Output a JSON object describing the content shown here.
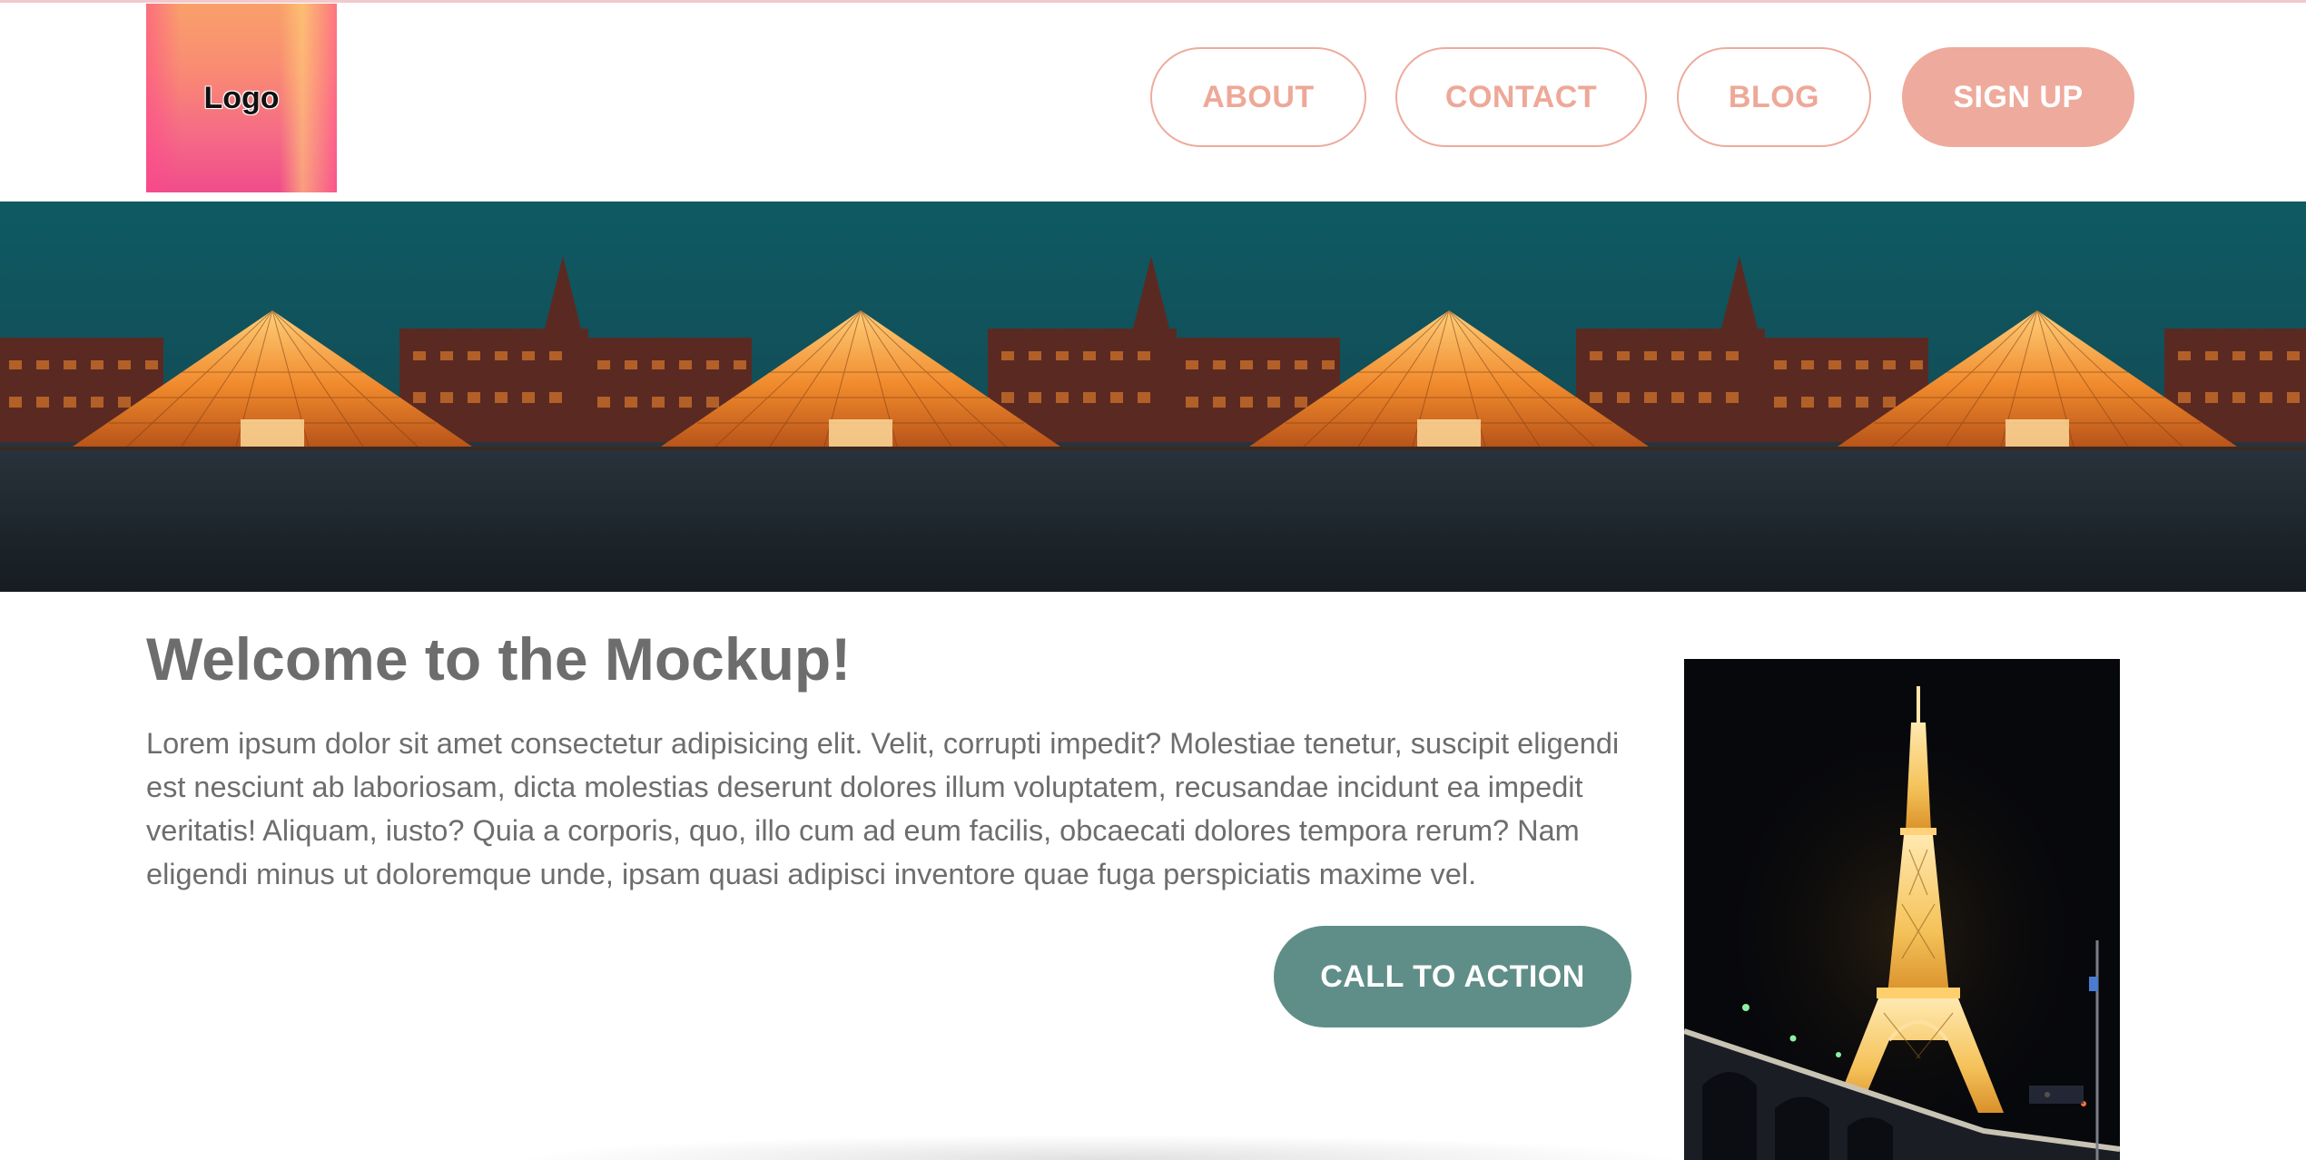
{
  "header": {
    "logo_label": "Logo",
    "nav": {
      "about": "ABOUT",
      "contact": "CONTACT",
      "blog": "BLOG",
      "signup": "SIGN UP"
    }
  },
  "hero": {
    "image": "louvre-pyramid-night-photo",
    "repeat_count": 4
  },
  "main": {
    "heading": "Welcome to the Mockup!",
    "body": "Lorem ipsum dolor sit amet consectetur adipisicing elit. Velit, corrupti impedit? Molestiae tenetur, suscipit eligendi est nesciunt ab laboriosam, dicta molestias deserunt dolores illum voluptatem, recusandae incidunt ea impedit veritatis! Aliquam, iusto? Quia a corporis, quo, illo cum ad eum facilis, obcaecati dolores tempora rerum? Nam eligendi minus ut doloremque unde, ipsam quasi adipisci inventore quae fuga perspiciatis maxime vel.",
    "cta_label": "CALL TO ACTION",
    "side_image": "eiffel-tower-night-photo"
  },
  "colors": {
    "accent": "#eeaa9c",
    "cta": "#5f8e88",
    "text": "#6d6d6d"
  }
}
